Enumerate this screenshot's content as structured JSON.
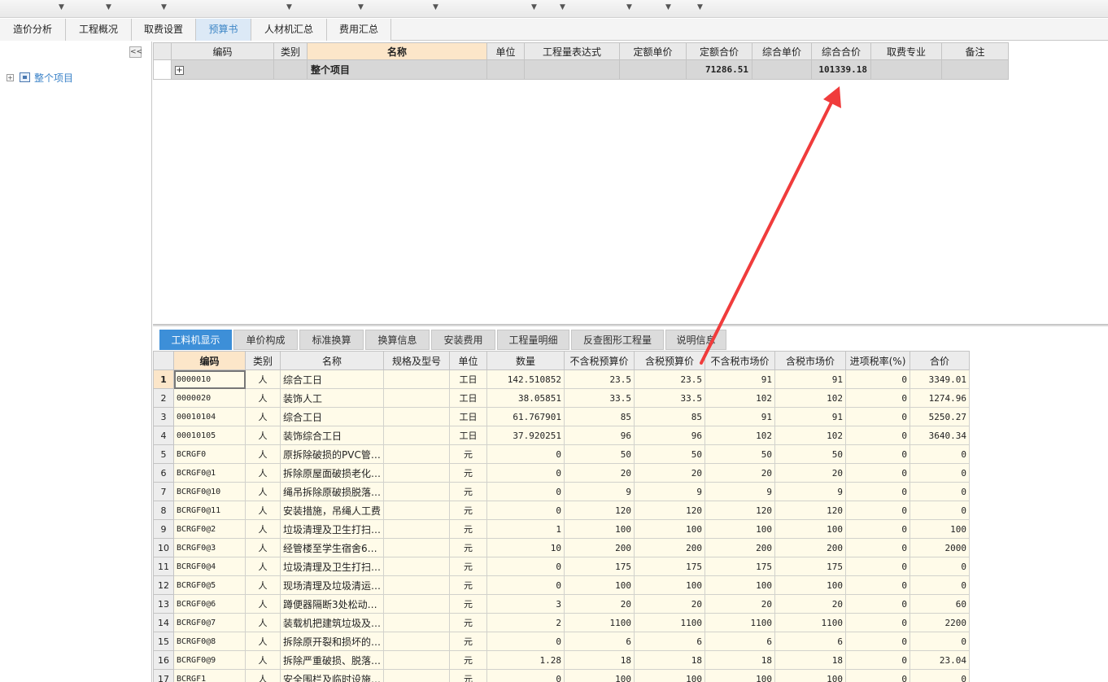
{
  "main_tabs": [
    "造价分析",
    "工程概况",
    "取费设置",
    "预算书",
    "人材机汇总",
    "费用汇总"
  ],
  "active_main_tab": "预算书",
  "left_panel": {
    "collapse_glyph": "<<",
    "tree_root": {
      "expander": "+",
      "label": "整个项目"
    }
  },
  "upper_table": {
    "columns": [
      "编码",
      "类别",
      "名称",
      "单位",
      "工程量表达式",
      "定额单价",
      "定额合价",
      "综合单价",
      "综合合价",
      "取费专业",
      "备注"
    ],
    "highlighted_column": "名称",
    "row": {
      "expander": "+",
      "code": "",
      "type": "",
      "name": "整个项目",
      "unit": "",
      "expr": "",
      "quota_unit_price": "",
      "quota_total": "71286.51",
      "comp_unit_price": "",
      "comp_total": "101339.18",
      "fee_major": "",
      "remark": ""
    }
  },
  "lower_tabs": [
    "工料机显示",
    "单价构成",
    "标准换算",
    "换算信息",
    "安装费用",
    "工程量明细",
    "反查图形工程量",
    "说明信息"
  ],
  "active_lower_tab": "工料机显示",
  "lower_table": {
    "columns": [
      "编码",
      "类别",
      "名称",
      "规格及型号",
      "单位",
      "数量",
      "不含税预算价",
      "含税预算价",
      "不含税市场价",
      "含税市场价",
      "进项税率(%)",
      "合价"
    ],
    "highlighted_column": "编码",
    "rows": [
      {
        "n": "1",
        "code": "0000010",
        "type": "人",
        "name": "综合工日",
        "spec": "",
        "unit": "工日",
        "qty": "142.510852",
        "p1": "23.5",
        "p2": "23.5",
        "p3": "91",
        "p4": "91",
        "tax": "0",
        "total": "3349.01"
      },
      {
        "n": "2",
        "code": "0000020",
        "type": "人",
        "name": "装饰人工",
        "spec": "",
        "unit": "工日",
        "qty": "38.05851",
        "p1": "33.5",
        "p2": "33.5",
        "p3": "102",
        "p4": "102",
        "tax": "0",
        "total": "1274.96"
      },
      {
        "n": "3",
        "code": "00010104",
        "type": "人",
        "name": "综合工日",
        "spec": "",
        "unit": "工日",
        "qty": "61.767901",
        "p1": "85",
        "p2": "85",
        "p3": "91",
        "p4": "91",
        "tax": "0",
        "total": "5250.27"
      },
      {
        "n": "4",
        "code": "00010105",
        "type": "人",
        "name": "装饰综合工日",
        "spec": "",
        "unit": "工日",
        "qty": "37.920251",
        "p1": "96",
        "p2": "96",
        "p3": "102",
        "p4": "102",
        "tax": "0",
        "total": "3640.34"
      },
      {
        "n": "5",
        "code": "BCRGF0",
        "type": "人",
        "name": "原拆除破损的PVC管…",
        "spec": "",
        "unit": "元",
        "qty": "0",
        "p1": "50",
        "p2": "50",
        "p3": "50",
        "p4": "50",
        "tax": "0",
        "total": "0"
      },
      {
        "n": "6",
        "code": "BCRGF0@1",
        "type": "人",
        "name": "拆除原屋面破损老化…",
        "spec": "",
        "unit": "元",
        "qty": "0",
        "p1": "20",
        "p2": "20",
        "p3": "20",
        "p4": "20",
        "tax": "0",
        "total": "0"
      },
      {
        "n": "7",
        "code": "BCRGF0@10",
        "type": "人",
        "name": "绳吊拆除原破损脱落…",
        "spec": "",
        "unit": "元",
        "qty": "0",
        "p1": "9",
        "p2": "9",
        "p3": "9",
        "p4": "9",
        "tax": "0",
        "total": "0"
      },
      {
        "n": "8",
        "code": "BCRGF0@11",
        "type": "人",
        "name": "安装措施，吊绳人工费",
        "spec": "",
        "unit": "元",
        "qty": "0",
        "p1": "120",
        "p2": "120",
        "p3": "120",
        "p4": "120",
        "tax": "0",
        "total": "0"
      },
      {
        "n": "9",
        "code": "BCRGF0@2",
        "type": "人",
        "name": "垃圾清理及卫生打扫…",
        "spec": "",
        "unit": "元",
        "qty": "1",
        "p1": "100",
        "p2": "100",
        "p3": "100",
        "p4": "100",
        "tax": "0",
        "total": "100"
      },
      {
        "n": "10",
        "code": "BCRGF0@3",
        "type": "人",
        "name": "经管楼至学生宿舍6…",
        "spec": "",
        "unit": "元",
        "qty": "10",
        "p1": "200",
        "p2": "200",
        "p3": "200",
        "p4": "200",
        "tax": "0",
        "total": "2000"
      },
      {
        "n": "11",
        "code": "BCRGF0@4",
        "type": "人",
        "name": "垃圾清理及卫生打扫…",
        "spec": "",
        "unit": "元",
        "qty": "0",
        "p1": "175",
        "p2": "175",
        "p3": "175",
        "p4": "175",
        "tax": "0",
        "total": "0"
      },
      {
        "n": "12",
        "code": "BCRGF0@5",
        "type": "人",
        "name": "现场清理及垃圾清运…",
        "spec": "",
        "unit": "元",
        "qty": "0",
        "p1": "100",
        "p2": "100",
        "p3": "100",
        "p4": "100",
        "tax": "0",
        "total": "0"
      },
      {
        "n": "13",
        "code": "BCRGF0@6",
        "type": "人",
        "name": "蹲便器隔断3处松动…",
        "spec": "",
        "unit": "元",
        "qty": "3",
        "p1": "20",
        "p2": "20",
        "p3": "20",
        "p4": "20",
        "tax": "0",
        "total": "60"
      },
      {
        "n": "14",
        "code": "BCRGF0@7",
        "type": "人",
        "name": "装载机把建筑垃圾及…",
        "spec": "",
        "unit": "元",
        "qty": "2",
        "p1": "1100",
        "p2": "1100",
        "p3": "1100",
        "p4": "1100",
        "tax": "0",
        "total": "2200"
      },
      {
        "n": "15",
        "code": "BCRGF0@8",
        "type": "人",
        "name": "拆除原开裂和损坏的…",
        "spec": "",
        "unit": "元",
        "qty": "0",
        "p1": "6",
        "p2": "6",
        "p3": "6",
        "p4": "6",
        "tax": "0",
        "total": "0"
      },
      {
        "n": "16",
        "code": "BCRGF0@9",
        "type": "人",
        "name": "拆除严重破损、脱落…",
        "spec": "",
        "unit": "元",
        "qty": "1.28",
        "p1": "18",
        "p2": "18",
        "p3": "18",
        "p4": "18",
        "tax": "0",
        "total": "23.04"
      },
      {
        "n": "17",
        "code": "BCRGF1",
        "type": "人",
        "name": "安全围栏及临时设施…",
        "spec": "",
        "unit": "元",
        "qty": "0",
        "p1": "100",
        "p2": "100",
        "p3": "100",
        "p4": "100",
        "tax": "0",
        "total": "0"
      }
    ]
  },
  "colors": {
    "active_tab_bg": "#dce9f6",
    "active_tab_text": "#3d86c6",
    "lower_active_tab": "#3d8fd8",
    "header_highlight": "#fce6c9",
    "cell_bg": "#fffbe9",
    "arrow": "#f03c3c"
  }
}
